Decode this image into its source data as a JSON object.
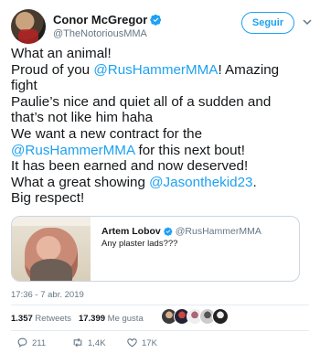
{
  "author": {
    "name": "Conor McGregor",
    "handle": "@TheNotoriousMMA",
    "follow_label": "Seguir"
  },
  "tweet": {
    "lines": [
      [
        {
          "t": "What an animal!"
        }
      ],
      [
        {
          "t": "Proud of you "
        },
        {
          "t": "@RusHammerMMA",
          "m": true
        },
        {
          "t": "! Amazing"
        }
      ],
      [
        {
          "t": "fight"
        }
      ],
      [
        {
          "t": "Paulie’s nice and quiet all of a sudden and"
        }
      ],
      [
        {
          "t": "that’s not like him haha"
        }
      ],
      [
        {
          "t": "We want a new contract for the"
        }
      ],
      [
        {
          "t": "@RusHammerMMA",
          "m": true
        },
        {
          "t": " for this next bout!"
        }
      ],
      [
        {
          "t": "It has been earned and now deserved!"
        }
      ],
      [
        {
          "t": "What a great showing "
        },
        {
          "t": "@Jasonthekid23",
          "m": true
        },
        {
          "t": "."
        }
      ],
      [
        {
          "t": "Big respect!"
        }
      ]
    ]
  },
  "quote": {
    "name": "Artem Lobov",
    "handle": "@RusHammerMMA",
    "text": "Any plaster lads???"
  },
  "timestamp": "17:36 - 7 abr. 2019",
  "stats": {
    "retweets_count": "1.357",
    "retweets_label": "Retweets",
    "likes_count": "17.399",
    "likes_label": "Me gusta"
  },
  "actions": {
    "reply_count": "211",
    "retweet_count": "1,4K",
    "like_count": "17K"
  },
  "colors": {
    "accent": "#1da1f2",
    "text": "#14171a",
    "muted": "#657786",
    "border": "#e6ecf0"
  },
  "icons": {
    "verified": "verified-badge-icon",
    "menu": "chevron-down-icon",
    "reply": "reply-icon",
    "retweet": "retweet-icon",
    "like": "heart-icon"
  }
}
